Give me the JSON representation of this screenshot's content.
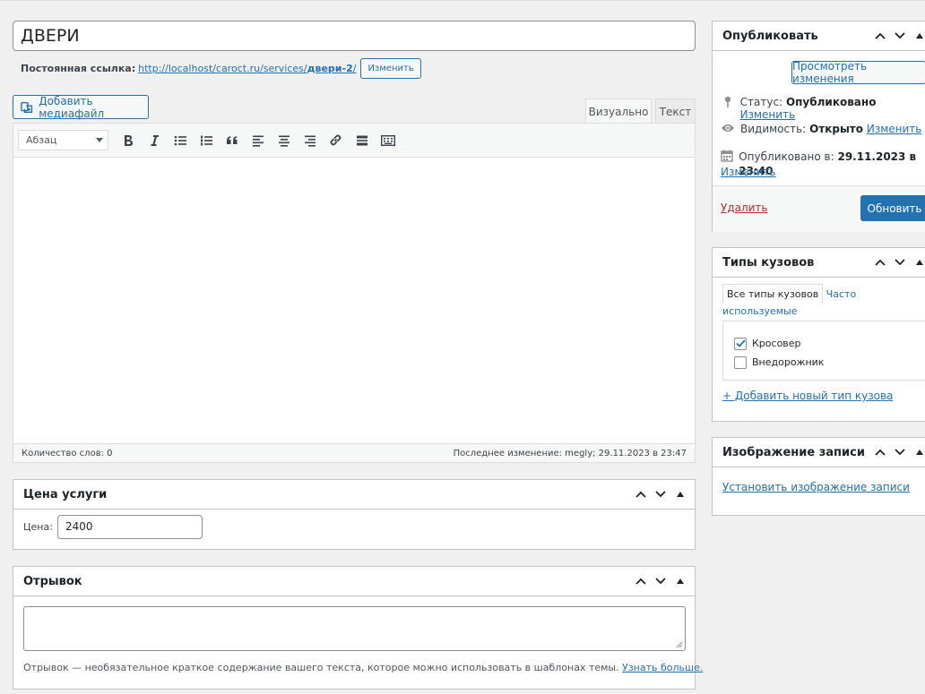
{
  "post": {
    "title": "ДВЕРИ"
  },
  "permalink": {
    "label": "Постоянная ссылка:",
    "url_prefix": "http://localhost/caroct.ru/services/",
    "slug": "двери-2",
    "url_suffix": "/",
    "edit_button": "Изменить"
  },
  "editor": {
    "add_media": "Добавить медиафайл",
    "tab_visual": "Визуально",
    "tab_text": "Текст",
    "format_select": "Абзац",
    "toolbar_icons": [
      "bold-icon",
      "italic-icon",
      "bullet-list-icon",
      "numbered-list-icon",
      "blockquote-icon",
      "align-left-icon",
      "align-center-icon",
      "align-right-icon",
      "link-icon",
      "read-more-icon",
      "toolbar-toggle-icon"
    ],
    "word_count": "Количество слов: 0",
    "last_edit": "Последнее изменение: megly; 29.11.2023 в 23:47"
  },
  "price_box": {
    "title": "Цена услуги",
    "label": "Цена:",
    "value": "2400"
  },
  "excerpt_box": {
    "title": "Отрывок",
    "help": "Отрывок — необязательное краткое содержание вашего текста, которое можно использовать в шаблонах темы.",
    "learn_more": "Узнать больше."
  },
  "publish_box": {
    "title": "Опубликовать",
    "preview_button": "Просмотреть изменения",
    "status_label": "Статус:",
    "status_value": "Опубликовано",
    "visibility_label": "Видимость:",
    "visibility_value": "Открыто",
    "published_label": "Опубликовано в:",
    "published_value": "29.11.2023 в 23:40",
    "edit_link": "Изменить",
    "delete_link": "Удалить",
    "update_button": "Обновить"
  },
  "body_types_box": {
    "title": "Типы кузовов",
    "tab_all": "Все типы кузовов",
    "tab_popular": "Часто используемые",
    "items": [
      {
        "label": "Кросовер",
        "checked": true
      },
      {
        "label": "Внедорожник",
        "checked": false
      }
    ],
    "add_link": "+ Добавить новый тип кузова"
  },
  "featured_box": {
    "title": "Изображение записи",
    "set_link": "Установить изображение записи"
  },
  "colors": {
    "accent": "#2271b1",
    "delete": "#b32d2e",
    "background": "#f0f0f1"
  }
}
